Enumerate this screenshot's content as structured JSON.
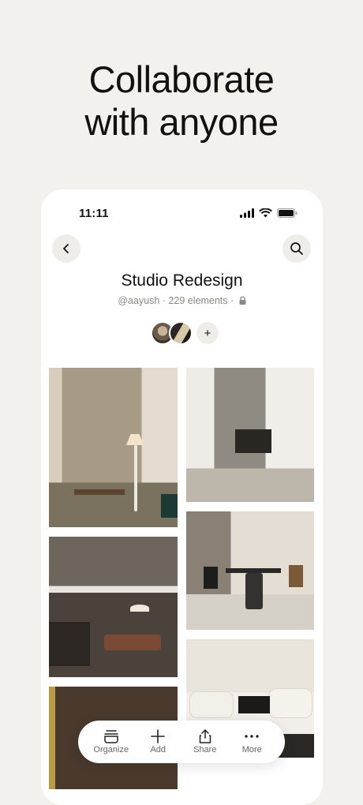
{
  "headline": {
    "line1": "Collaborate",
    "line2": "with anyone"
  },
  "status_bar": {
    "time": "11:11"
  },
  "board": {
    "title": "Studio Redesign",
    "meta": "@aayush · 229 elements ·"
  },
  "collaborators": {
    "add_label": "+"
  },
  "toolbar": {
    "items": [
      {
        "label": "Organize",
        "icon": "organize-icon"
      },
      {
        "label": "Add",
        "icon": "plus-icon"
      },
      {
        "label": "Share",
        "icon": "share-icon"
      },
      {
        "label": "More",
        "icon": "more-icon"
      }
    ]
  }
}
